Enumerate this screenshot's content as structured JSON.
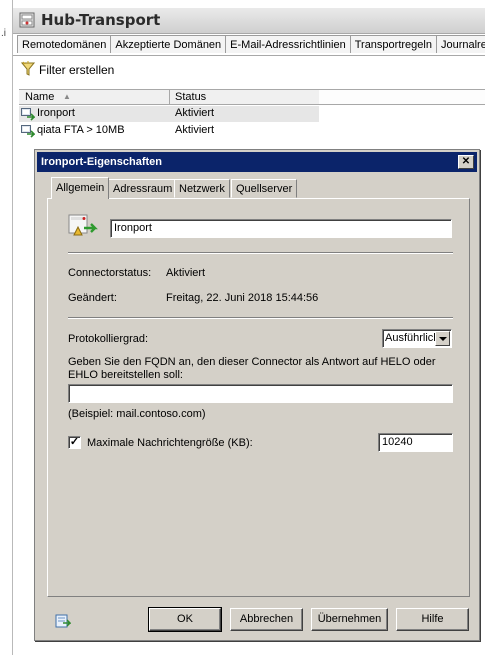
{
  "console": {
    "left_mark": ".i",
    "title": "Hub-Transport",
    "tabs": [
      {
        "label": "Remotedomänen"
      },
      {
        "label": "Akzeptierte Domänen"
      },
      {
        "label": "E-Mail-Adressrichtlinien"
      },
      {
        "label": "Transportregeln"
      },
      {
        "label": "Journalre"
      }
    ],
    "filter_label": "Filter erstellen",
    "columns": {
      "name": "Name",
      "status": "Status"
    },
    "rows": [
      {
        "name": "Ironport",
        "status": "Aktiviert",
        "icon": "connector-icon"
      },
      {
        "name": "qiata FTA > 10MB",
        "status": "Aktiviert",
        "icon": "connector-icon"
      }
    ]
  },
  "dialog": {
    "title": "Ironport-Eigenschaften",
    "close_glyph": "✕",
    "tabs": [
      {
        "label": "Allgemein"
      },
      {
        "label": "Adressraum"
      },
      {
        "label": "Netzwerk"
      },
      {
        "label": "Quellserver"
      }
    ],
    "name_value": "Ironport",
    "status_label": "Connectorstatus:",
    "status_value": "Aktiviert",
    "changed_label": "Geändert:",
    "changed_value": "Freitag, 22. Juni 2018 15:44:56",
    "protocol_label": "Protokolliergrad:",
    "protocol_value": "Ausführlich",
    "fqdn_prompt_line1": "Geben Sie den FQDN an, den dieser Connector als Antwort auf HELO oder",
    "fqdn_prompt_line2": "EHLO bereitstellen soll:",
    "fqdn_value": "",
    "fqdn_example": "(Beispiel: mail.contoso.com)",
    "max_size_checked": "✓",
    "max_size_label": "Maximale Nachrichtengröße (KB):",
    "max_size_value": "10240",
    "buttons": {
      "ok": "OK",
      "cancel": "Abbrechen",
      "apply": "Übernehmen",
      "help": "Hilfe"
    }
  }
}
